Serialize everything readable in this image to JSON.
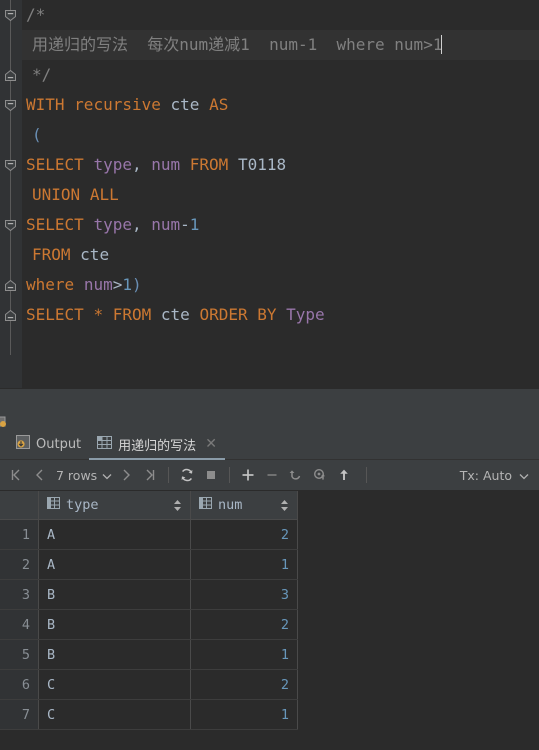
{
  "editor": {
    "lines": [
      {
        "fold": "start",
        "tokens": [
          {
            "t": "/*",
            "c": "comment"
          }
        ]
      },
      {
        "fold": "none",
        "caret": true,
        "indent": true,
        "tokens": [
          {
            "t": "用递归的写法  每次num递减1  num-1  where num>1",
            "c": "comment"
          }
        ]
      },
      {
        "fold": "end",
        "indent": true,
        "tokens": [
          {
            "t": "*/",
            "c": "comment"
          }
        ]
      },
      {
        "fold": "start",
        "tokens": [
          {
            "t": "WITH",
            "c": "kw"
          },
          {
            "t": " ",
            "c": "plain"
          },
          {
            "t": "recursive",
            "c": "kw"
          },
          {
            "t": " ",
            "c": "plain"
          },
          {
            "t": "cte",
            "c": "id"
          },
          {
            "t": " ",
            "c": "plain"
          },
          {
            "t": "AS",
            "c": "kw"
          }
        ]
      },
      {
        "fold": "none",
        "indent": true,
        "tokens": [
          {
            "t": "(",
            "c": "paren"
          }
        ]
      },
      {
        "fold": "start",
        "tokens": [
          {
            "t": "SELECT",
            "c": "kw"
          },
          {
            "t": " ",
            "c": "plain"
          },
          {
            "t": "type",
            "c": "col"
          },
          {
            "t": ", ",
            "c": "plain"
          },
          {
            "t": "num",
            "c": "col"
          },
          {
            "t": " ",
            "c": "plain"
          },
          {
            "t": "FROM",
            "c": "kw"
          },
          {
            "t": " ",
            "c": "plain"
          },
          {
            "t": "T0118",
            "c": "id"
          }
        ]
      },
      {
        "fold": "none",
        "indent": true,
        "tokens": [
          {
            "t": "UNION",
            "c": "kw"
          },
          {
            "t": " ",
            "c": "plain"
          },
          {
            "t": "ALL",
            "c": "kw"
          }
        ]
      },
      {
        "fold": "start",
        "tokens": [
          {
            "t": "SELECT",
            "c": "kw"
          },
          {
            "t": " ",
            "c": "plain"
          },
          {
            "t": "type",
            "c": "col"
          },
          {
            "t": ", ",
            "c": "plain"
          },
          {
            "t": "num",
            "c": "col"
          },
          {
            "t": "-",
            "c": "op"
          },
          {
            "t": "1",
            "c": "num"
          }
        ]
      },
      {
        "fold": "none",
        "indent": true,
        "tokens": [
          {
            "t": "FROM",
            "c": "kw"
          },
          {
            "t": " ",
            "c": "plain"
          },
          {
            "t": "cte",
            "c": "id"
          }
        ]
      },
      {
        "fold": "end",
        "tokens": [
          {
            "t": "where",
            "c": "kw"
          },
          {
            "t": " ",
            "c": "plain"
          },
          {
            "t": "num",
            "c": "col"
          },
          {
            "t": ">",
            "c": "op"
          },
          {
            "t": "1",
            "c": "num"
          },
          {
            "t": ")",
            "c": "paren"
          }
        ]
      },
      {
        "fold": "end",
        "tokens": [
          {
            "t": "SELECT",
            "c": "kw"
          },
          {
            "t": " ",
            "c": "plain"
          },
          {
            "t": "*",
            "c": "star"
          },
          {
            "t": " ",
            "c": "plain"
          },
          {
            "t": "FROM",
            "c": "kw"
          },
          {
            "t": " ",
            "c": "plain"
          },
          {
            "t": "cte",
            "c": "id"
          },
          {
            "t": " ",
            "c": "plain"
          },
          {
            "t": "ORDER",
            "c": "kw"
          },
          {
            "t": " ",
            "c": "plain"
          },
          {
            "t": "BY",
            "c": "kw"
          },
          {
            "t": " ",
            "c": "plain"
          },
          {
            "t": "Type",
            "c": "col"
          }
        ]
      }
    ]
  },
  "tabs": [
    {
      "label": "Output",
      "icon": "output-icon",
      "active": false,
      "closable": false
    },
    {
      "label": "用递归的写法",
      "icon": "table-grid-icon",
      "active": true,
      "closable": true,
      "close_label": "✕"
    }
  ],
  "toolbar": {
    "first_page": "first-page-icon",
    "prev_page": "previous-page-icon",
    "rows_label": "7 rows",
    "rows_chevron": "chevron-down-icon",
    "next_page": "next-page-icon",
    "last_page": "last-page-icon",
    "refresh": "refresh-icon",
    "stop": "stop-icon",
    "add_row": "add-row-icon",
    "delete_row": "delete-row-icon",
    "revert": "revert-icon",
    "commit": "commit-icon",
    "submit": "submit-icon",
    "tx_label": "Tx: Auto",
    "tx_chevron": "chevron-down-icon"
  },
  "result_grid": {
    "columns": [
      {
        "name": "type",
        "icon": "column-icon",
        "sort": "sort-arrows-icon"
      },
      {
        "name": "num",
        "icon": "column-icon",
        "sort": "sort-arrows-icon"
      }
    ],
    "rows": [
      {
        "n": "1",
        "type": "A",
        "num": "2"
      },
      {
        "n": "2",
        "type": "A",
        "num": "1"
      },
      {
        "n": "3",
        "type": "B",
        "num": "3"
      },
      {
        "n": "4",
        "type": "B",
        "num": "2"
      },
      {
        "n": "5",
        "type": "B",
        "num": "1"
      },
      {
        "n": "6",
        "type": "C",
        "num": "2"
      },
      {
        "n": "7",
        "type": "C",
        "num": "1"
      }
    ]
  },
  "colors": {
    "editor_bg": "#2b2b2b",
    "panel_bg": "#3c3f41",
    "gutter_bg": "#313335",
    "keyword": "#cc7832",
    "column": "#9876aa",
    "number": "#6897bb",
    "identifier": "#a9b7c6",
    "comment": "#808080",
    "tab_underline": "#8a9ba8"
  }
}
